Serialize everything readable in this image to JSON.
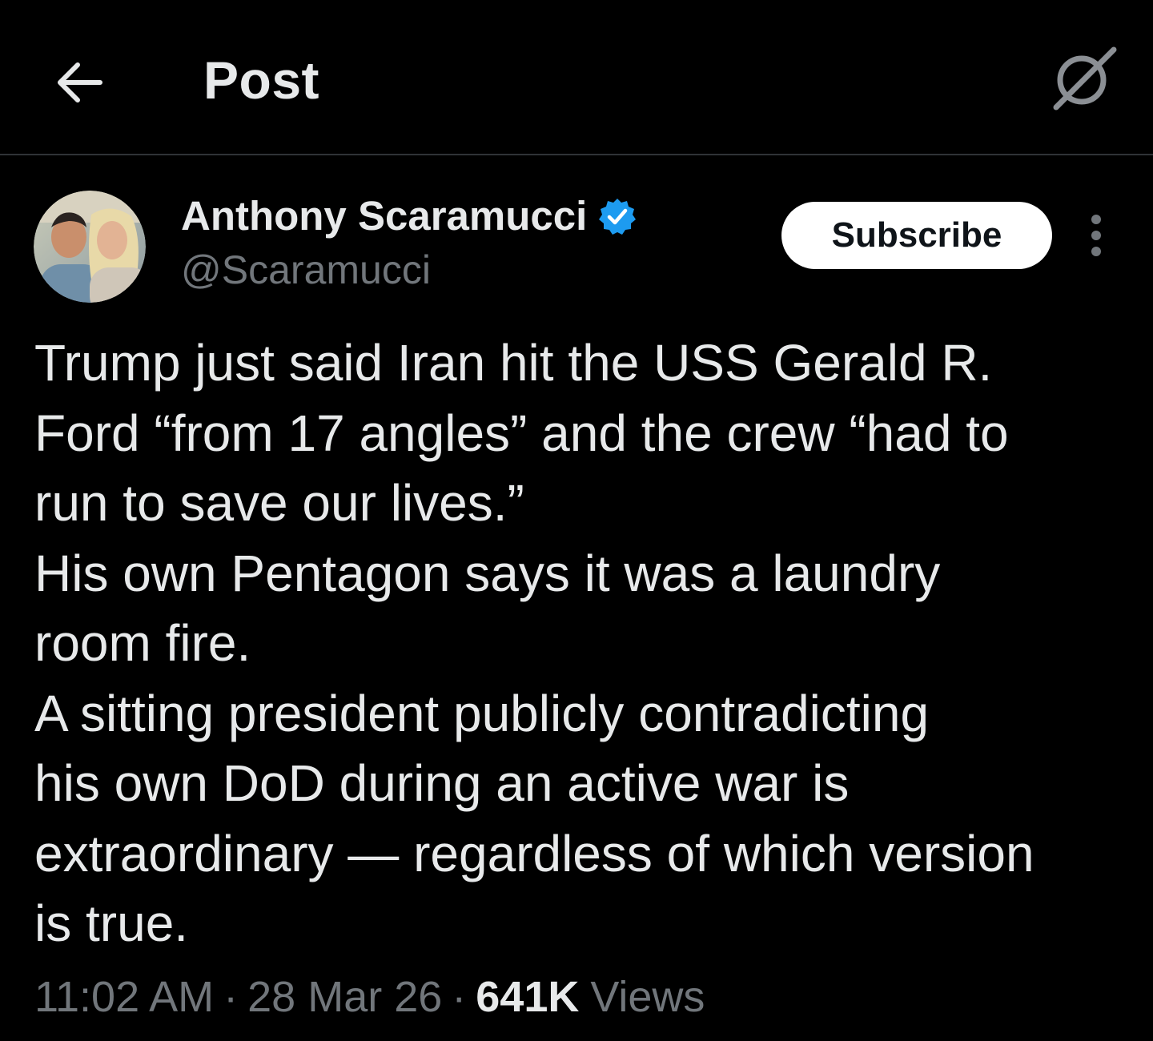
{
  "header": {
    "title": "Post",
    "back_icon": "arrow-left-icon",
    "grok_icon": "grok-icon"
  },
  "author": {
    "display_name": "Anthony Scaramucci",
    "handle": "@Scaramucci",
    "verified": true,
    "verified_color": "#1d9bf0",
    "avatar_icon": "profile-photo",
    "subscribe_label": "Subscribe",
    "more_icon": "more-vertical-icon"
  },
  "post": {
    "lines": [
      "Trump just said Iran hit the USS Gerald R.",
      "Ford “from 17 angles” and the crew “had to",
      "run to save our lives.”",
      "His own Pentagon says it was a laundry",
      "room fire.",
      "A sitting president publicly contradicting",
      "his own DoD during an active war is",
      "extraordinary — regardless of which version",
      "is true."
    ]
  },
  "meta": {
    "time": "11:02 AM",
    "separator": "·",
    "date": "28 Mar 26",
    "views_count": "641K",
    "views_label": "Views"
  },
  "colors": {
    "background": "#000000",
    "primary_text": "#e7e9ea",
    "secondary_text": "#71767b",
    "divider": "#2f3336"
  }
}
